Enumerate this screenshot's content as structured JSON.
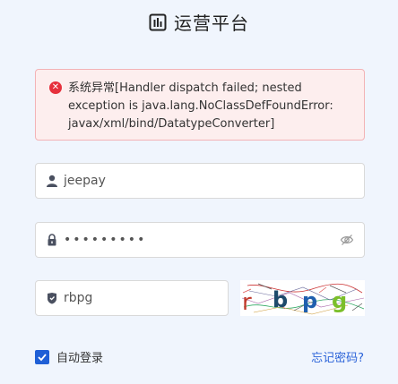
{
  "header": {
    "title": "运营平台",
    "logo_icon": "bar-chart-icon"
  },
  "alert": {
    "type": "error",
    "icon": "error-circle-icon",
    "message": "系统异常[Handler dispatch failed; nested exception is java.lang.NoClassDefFoundError: javax/xml/bind/DatatypeConverter]"
  },
  "form": {
    "username": {
      "value": "jeepay",
      "icon": "user-icon"
    },
    "password": {
      "value": "•••••••••",
      "icon": "lock-icon",
      "toggle_icon": "eye-hidden-icon"
    },
    "captcha": {
      "value": "rbpg",
      "icon": "shield-icon",
      "image_text": [
        "r",
        "b",
        "p",
        "g"
      ]
    }
  },
  "remember": {
    "label": "自动登录",
    "checked": true
  },
  "forgot_label": "忘记密码?",
  "colors": {
    "accent": "#1f5fd6",
    "error": "#e6303c",
    "link": "#2b63d9",
    "background": "#f0f5fd"
  }
}
